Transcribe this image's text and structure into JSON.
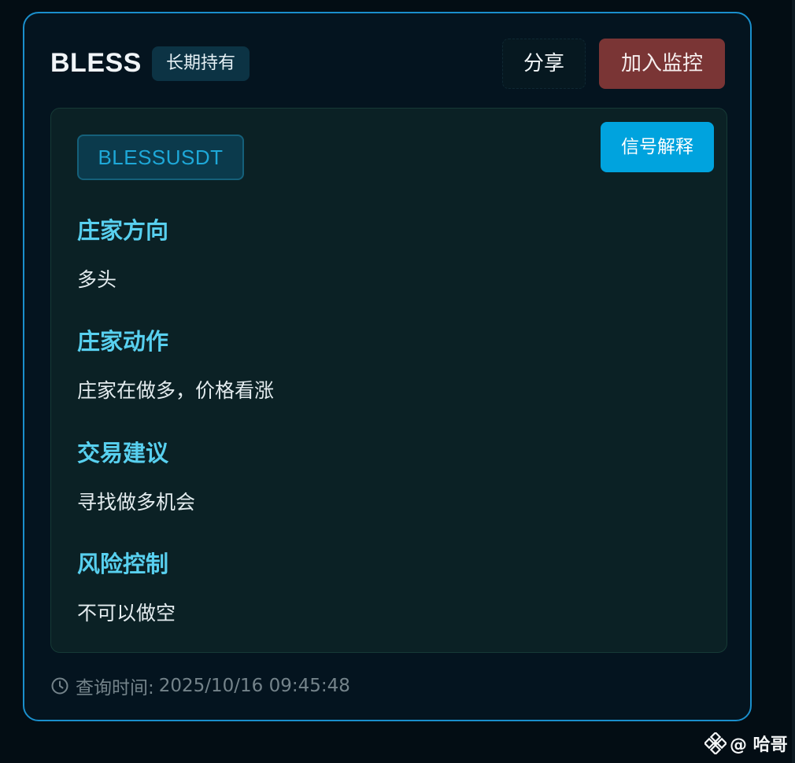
{
  "card": {
    "coin_name": "BLESS",
    "hold_tag": "长期持有",
    "share_label": "分享",
    "monitor_label": "加入监控"
  },
  "panel": {
    "symbol": "BLESSUSDT",
    "explain_label": "信号解释",
    "sections": [
      {
        "title": "庄家方向",
        "value": "多头"
      },
      {
        "title": "庄家动作",
        "value": "庄家在做多，价格看涨"
      },
      {
        "title": "交易建议",
        "value": "寻找做多机会"
      },
      {
        "title": "风险控制",
        "value": "不可以做空"
      }
    ]
  },
  "footer": {
    "query_label": "查询时间:",
    "query_time": "2025/10/16 09:45:48"
  },
  "watermark": {
    "text": "@ 哈哥"
  },
  "colors": {
    "card_border": "#1a8fcc",
    "monitor_button": "#7a3535",
    "explain_button": "#00a3de",
    "section_title": "#58d0ef",
    "symbol_tag_text": "#1ea8d8"
  },
  "icons": [
    "clock-icon",
    "binance-logo-icon"
  ]
}
